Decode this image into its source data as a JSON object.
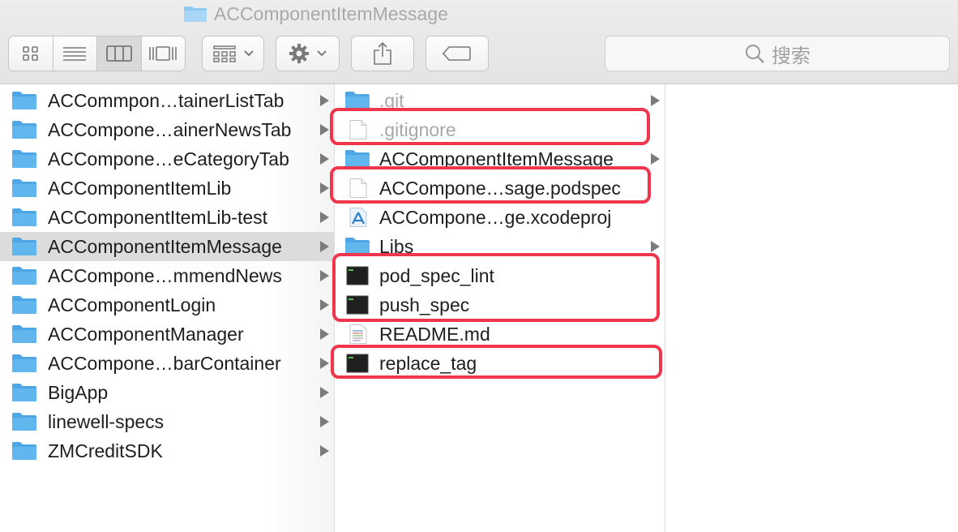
{
  "window": {
    "title": "ACComponentItemMessage"
  },
  "toolbar": {
    "view_buttons": [
      {
        "name": "icon-view-button",
        "icon": "grid-icon",
        "selected": false
      },
      {
        "name": "list-view-button",
        "icon": "list-icon",
        "selected": false
      },
      {
        "name": "column-view-button",
        "icon": "columns-icon",
        "selected": true
      },
      {
        "name": "gallery-view-button",
        "icon": "gallery-icon",
        "selected": false
      }
    ],
    "search_placeholder": "搜索"
  },
  "column1": {
    "items": [
      {
        "label": "ACCommpon…tainerListTab",
        "type": "folder",
        "has_children": true,
        "selected": false
      },
      {
        "label": "ACCompone…ainerNewsTab",
        "type": "folder",
        "has_children": true,
        "selected": false
      },
      {
        "label": "ACCompone…eCategoryTab",
        "type": "folder",
        "has_children": true,
        "selected": false
      },
      {
        "label": "ACComponentItemLib",
        "type": "folder",
        "has_children": true,
        "selected": false
      },
      {
        "label": "ACComponentItemLib-test",
        "type": "folder",
        "has_children": true,
        "selected": false
      },
      {
        "label": "ACComponentItemMessage",
        "type": "folder",
        "has_children": true,
        "selected": true
      },
      {
        "label": "ACCompone…mmendNews",
        "type": "folder",
        "has_children": true,
        "selected": false
      },
      {
        "label": "ACComponentLogin",
        "type": "folder",
        "has_children": true,
        "selected": false
      },
      {
        "label": "ACComponentManager",
        "type": "folder",
        "has_children": true,
        "selected": false
      },
      {
        "label": "ACCompone…barContainer",
        "type": "folder",
        "has_children": true,
        "selected": false
      },
      {
        "label": "BigApp",
        "type": "folder",
        "has_children": true,
        "selected": false
      },
      {
        "label": "linewell-specs",
        "type": "folder",
        "has_children": true,
        "selected": false
      },
      {
        "label": "ZMCreditSDK",
        "type": "folder",
        "has_children": true,
        "selected": false
      }
    ]
  },
  "column2": {
    "items": [
      {
        "label": ".git",
        "type": "folder",
        "has_children": true,
        "dimmed": true
      },
      {
        "label": ".gitignore",
        "type": "file",
        "has_children": false,
        "dimmed": true
      },
      {
        "label": "ACComponentItemMessage",
        "type": "folder",
        "has_children": true,
        "dimmed": false
      },
      {
        "label": "ACCompone…sage.podspec",
        "type": "file",
        "has_children": false,
        "dimmed": false
      },
      {
        "label": "ACCompone…ge.xcodeproj",
        "type": "xcodeproj",
        "has_children": false,
        "dimmed": false
      },
      {
        "label": "Libs",
        "type": "folder",
        "has_children": true,
        "dimmed": false
      },
      {
        "label": "pod_spec_lint",
        "type": "exec",
        "has_children": false,
        "dimmed": false
      },
      {
        "label": "push_spec",
        "type": "exec",
        "has_children": false,
        "dimmed": false
      },
      {
        "label": "README.md",
        "type": "text",
        "has_children": false,
        "dimmed": false
      },
      {
        "label": "replace_tag",
        "type": "exec",
        "has_children": false,
        "dimmed": false
      }
    ]
  },
  "colors": {
    "folder": "#5fb4ec",
    "highlight_box": "#f0364c",
    "selection": "#dcdcdc"
  }
}
